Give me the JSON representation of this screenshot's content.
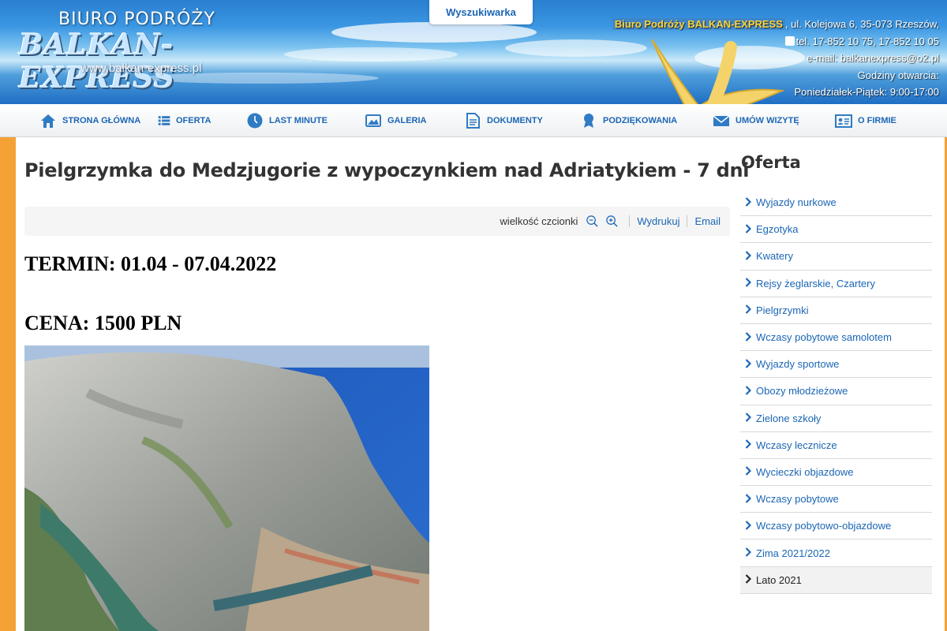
{
  "header": {
    "logo_top": "BIURO PODRÓŻY",
    "logo_main": "BALKAN-EXPRESS",
    "logo_url": "www.balkan-express.pl",
    "search_tab": "Wyszukiwarka",
    "company": "Biuro Podróży BALKAN-EXPRESS",
    "address": ", ul. Kolejowa 6, 35-073 Rzeszów,",
    "phone": "tel. 17-852 10 75, 17-852 10 05",
    "email": "e-mail: balkanexpress@o2.pl",
    "hours_label": "Godziny otwarcia:",
    "hours": "Poniedziałek-Piątek: 9:00-17:00"
  },
  "nav": [
    {
      "label": "STRONA GŁÓWNA",
      "icon": "home-icon"
    },
    {
      "label": "OFERTA",
      "icon": "list-icon"
    },
    {
      "label": "LAST MINUTE",
      "icon": "clock-icon"
    },
    {
      "label": "GALERIA",
      "icon": "gallery-icon"
    },
    {
      "label": "DOKUMENTY",
      "icon": "document-icon"
    },
    {
      "label": "PODZIĘKOWANIA",
      "icon": "award-icon"
    },
    {
      "label": "UMÓW WIZYTĘ",
      "icon": "envelope-icon"
    },
    {
      "label": "O FIRMIE",
      "icon": "id-card-icon"
    }
  ],
  "article": {
    "title": "Pielgrzymka do Medzjugorie z wypoczynkiem nad Adriatykiem - 7 dni",
    "font_size_label": "wielkość czcionki",
    "print": "Wydrukuj",
    "email": "Email",
    "term": "TERMIN: 01.04 - 07.04.2022",
    "price": "CENA: 1500 PLN"
  },
  "sidebar": {
    "title": "Oferta",
    "items": [
      "Wyjazdy nurkowe",
      "Egzotyka",
      "Kwatery",
      "Rejsy żeglarskie, Czartery",
      "Pielgrzymki",
      "Wczasy pobytowe samolotem",
      "Wyjazdy sportowe",
      "Obozy młodzieżowe",
      "Zielone szkoły",
      "Wczasy lecznicze",
      "Wycieczki objazdowe",
      "Wczasy pobytowe",
      "Wczasy pobytowo-objazdowe",
      "Zima 2021/2022",
      "Lato 2021"
    ],
    "active_index": 14
  },
  "colors": {
    "link": "#1b66b5",
    "accent_orange": "#f4a236",
    "company_highlight": "#ffd33a"
  }
}
